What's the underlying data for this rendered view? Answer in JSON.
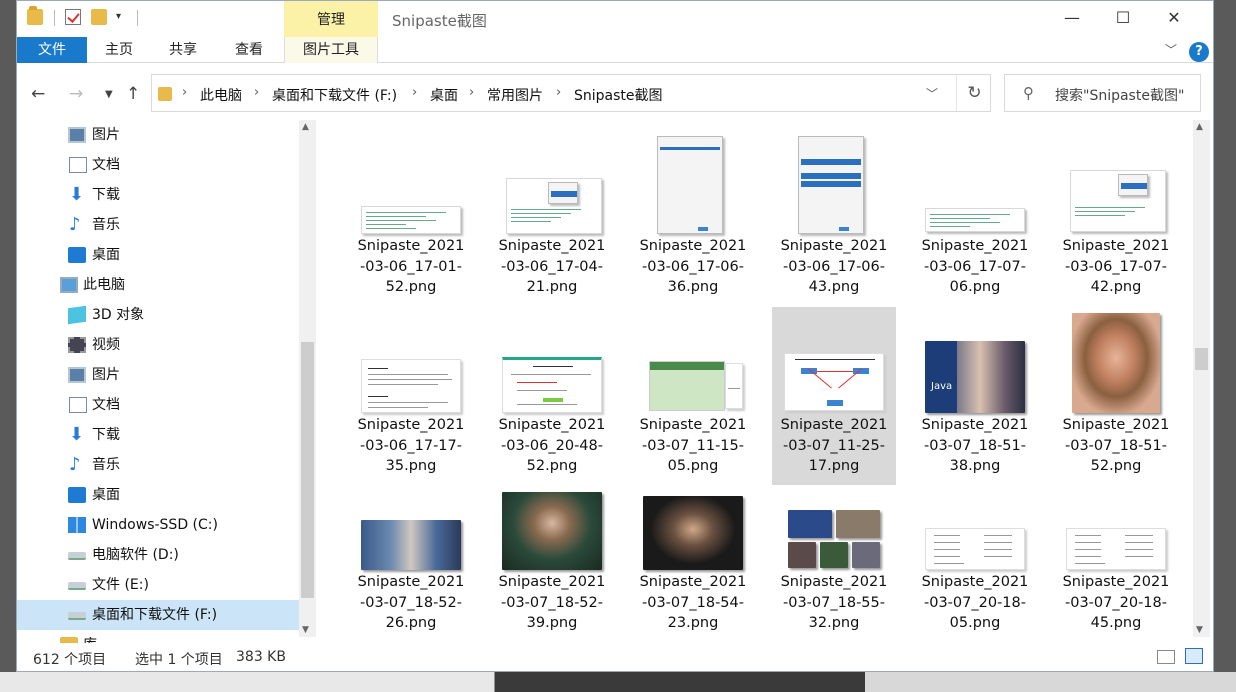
{
  "title": {
    "manage_label": "管理",
    "window_title": "Snipaste截图"
  },
  "ribbon": {
    "tabs": [
      "文件",
      "主页",
      "共享",
      "查看",
      "图片工具"
    ],
    "help": "?"
  },
  "address": {
    "crumbs": [
      "此电脑",
      "桌面和下载文件 (F:)",
      "桌面",
      "常用图片",
      "Snipaste截图"
    ],
    "search_placeholder": "搜索\"Snipaste截图\""
  },
  "nav": {
    "items": [
      {
        "label": "图片",
        "icon": "pictures-icon"
      },
      {
        "label": "文档",
        "icon": "documents-icon"
      },
      {
        "label": "下载",
        "icon": "downloads-icon"
      },
      {
        "label": "音乐",
        "icon": "music-icon"
      },
      {
        "label": "桌面",
        "icon": "desktop-icon"
      },
      {
        "label": "此电脑",
        "icon": "this-pc-icon"
      },
      {
        "label": "3D 对象",
        "icon": "3d-objects-icon"
      },
      {
        "label": "视频",
        "icon": "videos-icon"
      },
      {
        "label": "图片",
        "icon": "pictures-icon"
      },
      {
        "label": "文档",
        "icon": "documents-icon"
      },
      {
        "label": "下载",
        "icon": "downloads-icon"
      },
      {
        "label": "音乐",
        "icon": "music-icon"
      },
      {
        "label": "桌面",
        "icon": "desktop-icon"
      },
      {
        "label": "Windows-SSD (C:)",
        "icon": "windows-drive-icon"
      },
      {
        "label": "电脑软件 (D:)",
        "icon": "drive-icon"
      },
      {
        "label": "文件 (E:)",
        "icon": "drive-icon"
      },
      {
        "label": "桌面和下载文件 (F:)",
        "icon": "drive-icon",
        "selected": true
      },
      {
        "label": "库",
        "icon": "library-icon"
      }
    ]
  },
  "files": [
    {
      "name": "Snipaste_2021-03-06_17-01-52.png",
      "lines": [
        "Snipaste_2021",
        "-03-06_17-01-",
        "52.png"
      ],
      "thumb": "code"
    },
    {
      "name": "Snipaste_2021-03-06_17-04-21.png",
      "lines": [
        "Snipaste_2021",
        "-03-06_17-04-",
        "21.png"
      ],
      "thumb": "code-popup"
    },
    {
      "name": "Snipaste_2021-03-06_17-06-36.png",
      "lines": [
        "Snipaste_2021",
        "-03-06_17-06-",
        "36.png"
      ],
      "thumb": "dialog"
    },
    {
      "name": "Snipaste_2021-03-06_17-06-43.png",
      "lines": [
        "Snipaste_2021",
        "-03-06_17-06-",
        "43.png"
      ],
      "thumb": "dialog-list"
    },
    {
      "name": "Snipaste_2021-03-06_17-07-06.png",
      "lines": [
        "Snipaste_2021",
        "-03-06_17-07-",
        "06.png"
      ],
      "thumb": "code"
    },
    {
      "name": "Snipaste_2021-03-06_17-07-42.png",
      "lines": [
        "Snipaste_2021",
        "-03-06_17-07-",
        "42.png"
      ],
      "thumb": "code-popup"
    },
    {
      "name": "Snipaste_2021-03-06_17-17-35.png",
      "lines": [
        "Snipaste_2021",
        "-03-06_17-17-",
        "35.png"
      ],
      "thumb": "text"
    },
    {
      "name": "Snipaste_2021-03-06_20-48-52.png",
      "lines": [
        "Snipaste_2021",
        "-03-06_20-48-",
        "52.png"
      ],
      "thumb": "diagram"
    },
    {
      "name": "Snipaste_2021-03-07_11-15-05.png",
      "lines": [
        "Snipaste_2021",
        "-03-07_11-15-",
        "05.png"
      ],
      "thumb": "table-green"
    },
    {
      "name": "Snipaste_2021-03-07_11-25-17.png",
      "lines": [
        "Snipaste_2021",
        "-03-07_11-25-",
        "17.png"
      ],
      "thumb": "diagram",
      "selected": true
    },
    {
      "name": "Snipaste_2021-03-07_18-51-38.png",
      "lines": [
        "Snipaste_2021",
        "-03-07_18-51-",
        "38.png"
      ],
      "thumb": "photo-java"
    },
    {
      "name": "Snipaste_2021-03-07_18-51-52.png",
      "lines": [
        "Snipaste_2021",
        "-03-07_18-51-",
        "52.png"
      ],
      "thumb": "photo-portrait"
    },
    {
      "name": "Snipaste_2021-03-07_18-52-26.png",
      "lines": [
        "Snipaste_2021",
        "-03-07_18-52-",
        "26.png"
      ],
      "thumb": "photo-desk"
    },
    {
      "name": "Snipaste_2021-03-07_18-52-39.png",
      "lines": [
        "Snipaste_2021",
        "-03-07_18-52-",
        "39.png"
      ],
      "thumb": "photo-talk"
    },
    {
      "name": "Snipaste_2021-03-07_18-54-23.png",
      "lines": [
        "Snipaste_2021",
        "-03-07_18-54-",
        "23.png"
      ],
      "thumb": "photo-talk2"
    },
    {
      "name": "Snipaste_2021-03-07_18-55-32.png",
      "lines": [
        "Snipaste_2021",
        "-03-07_18-55-",
        "32.png"
      ],
      "thumb": "photo-grid"
    },
    {
      "name": "Snipaste_2021-03-07_20-18-05.png",
      "lines": [
        "Snipaste_2021",
        "-03-07_20-18-",
        "05.png"
      ],
      "thumb": "list"
    },
    {
      "name": "Snipaste_2021-03-07_20-18-45.png",
      "lines": [
        "Snipaste_2021",
        "-03-07_20-18-",
        "45.png"
      ],
      "thumb": "list"
    }
  ],
  "status": {
    "count": "612 个项目",
    "selection": "选中 1 个项目",
    "size": "383 KB"
  },
  "colors": {
    "accent": "#1979ca",
    "manage_tab": "#fbf2a8",
    "selection": "#cce4f7"
  }
}
